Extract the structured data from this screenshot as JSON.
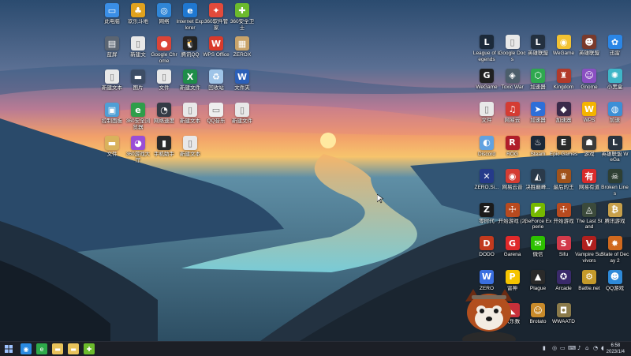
{
  "desktop": {
    "left_icons": [
      {
        "label": "此电脑",
        "icon": "pc-icon",
        "color": "#3a8ee6",
        "glyph": "▭"
      },
      {
        "label": "欢乐斗地",
        "icon": "game-icon",
        "color": "#e0a21e",
        "glyph": "♣"
      },
      {
        "label": "网络",
        "icon": "network-icon",
        "color": "#2f86d8",
        "glyph": "◎"
      },
      {
        "label": "Internet Explorer",
        "icon": "ie-icon",
        "color": "#1f78d1",
        "glyph": "e"
      },
      {
        "label": "360软件管家",
        "icon": "app-manager-icon",
        "color": "#e24a3b",
        "glyph": "✦"
      },
      {
        "label": "360安全卫士",
        "icon": "360-icon",
        "color": "#6cbb2c",
        "glyph": "✚"
      },
      {
        "label": "蓝屏",
        "icon": "drive-icon",
        "color": "#5b6572",
        "glyph": "▤"
      },
      {
        "label": "新建文",
        "icon": "file-icon",
        "color": "#e8e8e8",
        "glyph": "▯"
      },
      {
        "label": "Google Chrome",
        "icon": "chrome-icon",
        "color": "#db4437",
        "glyph": "●"
      },
      {
        "label": "腾讯QQ",
        "icon": "qq-icon",
        "color": "#222222",
        "glyph": "🐧"
      },
      {
        "label": "WPS Office",
        "icon": "wps-icon",
        "color": "#d93a2b",
        "glyph": "W"
      },
      {
        "label": "ZEROX",
        "icon": "archive-icon",
        "color": "#c9a36a",
        "glyph": "▦"
      },
      {
        "label": "新建文本",
        "icon": "file-icon",
        "color": "#e8e8e8",
        "glyph": "▯"
      },
      {
        "label": "图片",
        "icon": "image-icon",
        "color": "#3d4d66",
        "glyph": "▬"
      },
      {
        "label": "文件",
        "icon": "file-icon",
        "color": "#e8e8e8",
        "glyph": "▯"
      },
      {
        "label": "新建文件",
        "icon": "excel-icon",
        "color": "#1f8d49",
        "glyph": "X"
      },
      {
        "label": "回收站",
        "icon": "recycle-bin-icon",
        "color": "#9ec4e8",
        "glyph": "♻"
      },
      {
        "label": "文件夹",
        "icon": "word-icon",
        "color": "#2b5fb8",
        "glyph": "W"
      },
      {
        "label": "控制面板",
        "icon": "control-panel-icon",
        "color": "#4f9fd6",
        "glyph": "▣"
      },
      {
        "label": "360安全浏览器",
        "icon": "browser-icon",
        "color": "#2e9e4a",
        "glyph": "e"
      },
      {
        "label": "网络速度",
        "icon": "speed-icon",
        "color": "#343b45",
        "glyph": "◔"
      },
      {
        "label": "新建文本",
        "icon": "file-icon",
        "color": "#e8e8e8",
        "glyph": "▯"
      },
      {
        "label": "QQ音乐",
        "icon": "folder-icon",
        "color": "#eeeeee",
        "glyph": "▭"
      },
      {
        "label": "新建文件",
        "icon": "file-icon",
        "color": "#e8e8e8",
        "glyph": "▯"
      },
      {
        "label": "文件",
        "icon": "folder-icon",
        "color": "#d9b25c",
        "glyph": "▬"
      },
      {
        "label": "360游戏大厅",
        "icon": "game-center-icon",
        "color": "#9a4ed6",
        "glyph": "◕"
      },
      {
        "label": "手机助手",
        "icon": "phone-icon",
        "color": "#2b2b2b",
        "glyph": "▮"
      },
      {
        "label": "新建文本",
        "icon": "file-icon",
        "color": "#e8e8e8",
        "glyph": "▯"
      }
    ],
    "right_icons": [
      {
        "label": "League of Legends",
        "icon": "lol-icon",
        "color": "#1c2a3a",
        "glyph": "L"
      },
      {
        "label": "Google Docs",
        "icon": "doc-icon",
        "color": "#e9e9e9",
        "glyph": "▯"
      },
      {
        "label": "英雄联盟",
        "icon": "lol-icon",
        "color": "#23303f",
        "glyph": "L"
      },
      {
        "label": "WeGame",
        "icon": "wegame-icon",
        "color": "#f2c232",
        "glyph": "◉"
      },
      {
        "label": "英雄联盟",
        "icon": "hero-icon",
        "color": "#7a3a2b",
        "glyph": "☻"
      },
      {
        "label": "迅雷",
        "icon": "cloud-icon",
        "color": "#2b86e6",
        "glyph": "✿"
      },
      {
        "label": "WeGame",
        "icon": "wegame-icon",
        "color": "#202020",
        "glyph": "G"
      },
      {
        "label": "Toxic War",
        "icon": "war-icon",
        "color": "#4c5e6b",
        "glyph": "◈"
      },
      {
        "label": "加速器",
        "icon": "accelerator-icon",
        "color": "#2fa84f",
        "glyph": "⬡"
      },
      {
        "label": "Kingdom",
        "icon": "kingdom-icon",
        "color": "#b23a2a",
        "glyph": "♜"
      },
      {
        "label": "Gnome",
        "icon": "character-icon",
        "color": "#8a4fc2",
        "glyph": "☺"
      },
      {
        "label": "小黑盒",
        "icon": "mouse-icon",
        "color": "#3fb6c8",
        "glyph": "✺"
      },
      {
        "label": "文件",
        "icon": "file-icon",
        "color": "#e8e8e8",
        "glyph": "▯"
      },
      {
        "label": "网易云",
        "icon": "music-icon",
        "color": "#d43c33",
        "glyph": "♫"
      },
      {
        "label": "加速器",
        "icon": "boost-icon",
        "color": "#2e6fd8",
        "glyph": "➤"
      },
      {
        "label": "加速器",
        "icon": "game-icon",
        "color": "#3a2a4a",
        "glyph": "◆"
      },
      {
        "label": "WPS",
        "icon": "wps-icon",
        "color": "#f4b400",
        "glyph": "W"
      },
      {
        "label": "加速",
        "icon": "globe-icon",
        "color": "#3c8fd6",
        "glyph": "◍"
      },
      {
        "label": "Discord",
        "icon": "discord-icon",
        "color": "#62a2e0",
        "glyph": "◐"
      },
      {
        "label": "ROG",
        "icon": "rog-icon",
        "color": "#b01e2a",
        "glyph": "R"
      },
      {
        "label": "Steam",
        "icon": "steam-icon",
        "color": "#1b2838",
        "glyph": "♨"
      },
      {
        "label": "Epic Games",
        "icon": "epic-icon",
        "color": "#2a2a2a",
        "glyph": "E"
      },
      {
        "label": "游戏",
        "icon": "game-icon",
        "color": "#3b3b3b",
        "glyph": "☗"
      },
      {
        "label": "英雄联盟 WeGa",
        "icon": "lol-icon",
        "color": "#2a3440",
        "glyph": "L"
      },
      {
        "label": "ZERO.Si...",
        "icon": "zero-icon",
        "color": "#253a8a",
        "glyph": "✕"
      },
      {
        "label": "网易云音",
        "icon": "music-icon",
        "color": "#d43c33",
        "glyph": "◉"
      },
      {
        "label": "决胜巅峰...",
        "icon": "game-icon",
        "color": "#2a3a4a",
        "glyph": "◭"
      },
      {
        "label": "最后的王",
        "icon": "game-icon",
        "color": "#a0521b",
        "glyph": "♛"
      },
      {
        "label": "网易有道",
        "icon": "dict-icon",
        "color": "#d92b2b",
        "glyph": "有"
      },
      {
        "label": "Broken Lines",
        "icon": "game-icon",
        "color": "#2e3f33",
        "glyph": "☠"
      },
      {
        "label": "零时代",
        "icon": "zero-icon",
        "color": "#1b1b1b",
        "glyph": "Z"
      },
      {
        "label": "开始游戏 (2)",
        "icon": "game-icon",
        "color": "#b84a1f",
        "glyph": "☩"
      },
      {
        "label": "GeForce Experie",
        "icon": "nvidia-icon",
        "color": "#76b900",
        "glyph": "◤"
      },
      {
        "label": "开始游戏",
        "icon": "game-icon",
        "color": "#b84a1f",
        "glyph": "☩"
      },
      {
        "label": "The Last Stand",
        "icon": "game-icon",
        "color": "#3b4a3b",
        "glyph": "◬"
      },
      {
        "label": "腾讯游戏",
        "icon": "game-icon",
        "color": "#c8a04a",
        "glyph": "₿"
      },
      {
        "label": "DODO",
        "icon": "game-icon",
        "color": "#c23a1e",
        "glyph": "D"
      },
      {
        "label": "Garena",
        "icon": "garena-icon",
        "color": "#e0292a",
        "glyph": "G"
      },
      {
        "label": "微信",
        "icon": "wechat-icon",
        "color": "#2dc100",
        "glyph": "✉"
      },
      {
        "label": "Sifu",
        "icon": "game-icon",
        "color": "#d23a4a",
        "glyph": "S"
      },
      {
        "label": "Vampire Survivors",
        "icon": "game-icon",
        "color": "#b0201e",
        "glyph": "V"
      },
      {
        "label": "State of Decay 2",
        "icon": "game-icon",
        "color": "#d0691e",
        "glyph": "✸"
      },
      {
        "label": "ZERO",
        "icon": "zero-icon",
        "color": "#3a6fe0",
        "glyph": "W"
      },
      {
        "label": "雷神",
        "icon": "game-icon",
        "color": "#f5c400",
        "glyph": "P"
      },
      {
        "label": "Plague",
        "icon": "game-icon",
        "color": "#2a2a2a",
        "glyph": "▲"
      },
      {
        "label": "Arcade",
        "icon": "arcade-icon",
        "color": "#3a2a6a",
        "glyph": "✪"
      },
      {
        "label": "Battle.net",
        "icon": "battlenet-icon",
        "color": "#c49a2a",
        "glyph": "⚙"
      },
      {
        "label": "QQ游戏",
        "icon": "qq-game-icon",
        "color": "#2e8ad8",
        "glyph": "☻"
      },
      {
        "label": "英雄联盟",
        "icon": "lol-icon",
        "color": "#1f2a36",
        "glyph": "L"
      },
      {
        "label": "大乐数",
        "icon": "game-icon",
        "color": "#c8303a",
        "glyph": "◣"
      },
      {
        "label": "Brotato",
        "icon": "brotato-icon",
        "color": "#c88a2a",
        "glyph": "☺"
      },
      {
        "label": "WWAATD",
        "icon": "game-icon",
        "color": "#8a7a4a",
        "glyph": "◘"
      }
    ]
  },
  "taskbar": {
    "start_icon": "windows-start-icon",
    "pinned": [
      {
        "name": "browser-icon",
        "color": "#2a8ae0",
        "glyph": "◉"
      },
      {
        "name": "360-browser-icon",
        "color": "#2eaa4a",
        "glyph": "e"
      },
      {
        "name": "file-explorer-icon",
        "color": "#e8c25a",
        "glyph": "▬"
      },
      {
        "name": "documents-icon",
        "color": "#e8c25a",
        "glyph": "▬"
      },
      {
        "name": "360-icon",
        "color": "#6cbb2c",
        "glyph": "✚"
      }
    ],
    "tray": {
      "time": "6:58",
      "date": "2023/1/4"
    }
  }
}
